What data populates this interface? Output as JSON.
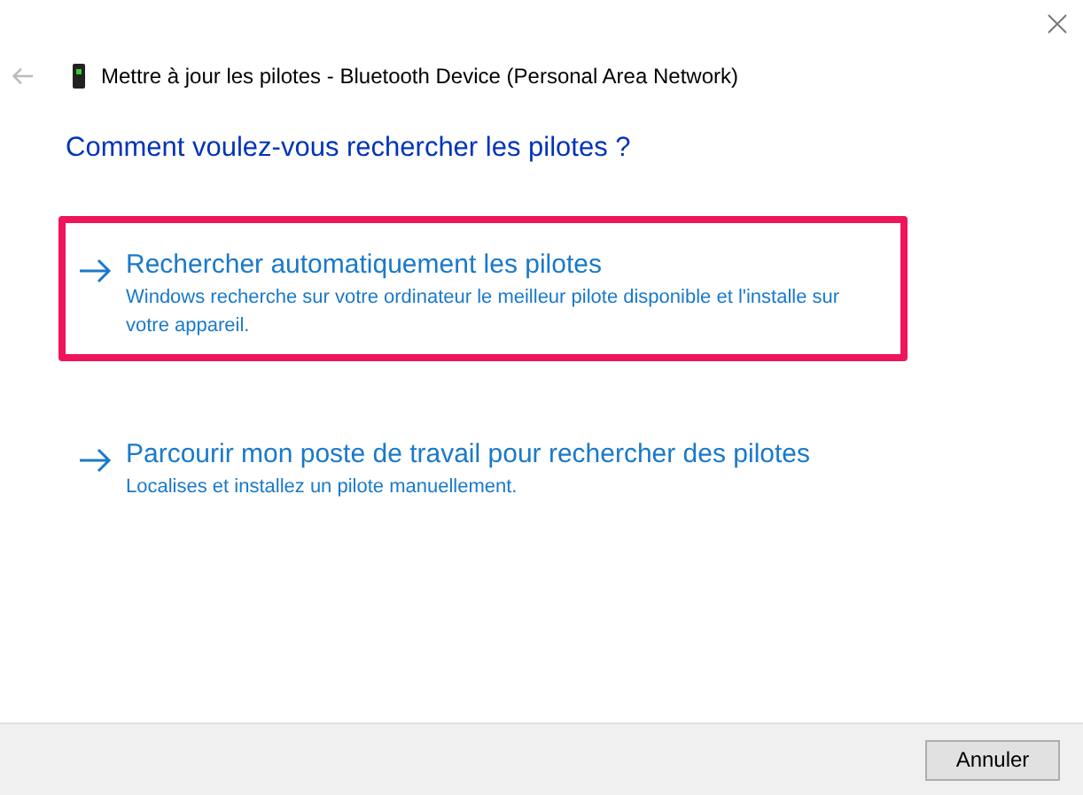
{
  "window": {
    "title": "Mettre à jour les pilotes - Bluetooth Device (Personal Area Network)"
  },
  "heading": "Comment voulez-vous rechercher les pilotes ?",
  "options": [
    {
      "title": "Rechercher automatiquement les pilotes",
      "description": "Windows recherche sur votre ordinateur le meilleur pilote disponible et l'installe sur votre appareil.",
      "highlighted": true
    },
    {
      "title": "Parcourir mon poste de travail pour rechercher des pilotes",
      "description": "Localises et installez un pilote manuellement.",
      "highlighted": false
    }
  ],
  "buttons": [
    "Annuler"
  ]
}
